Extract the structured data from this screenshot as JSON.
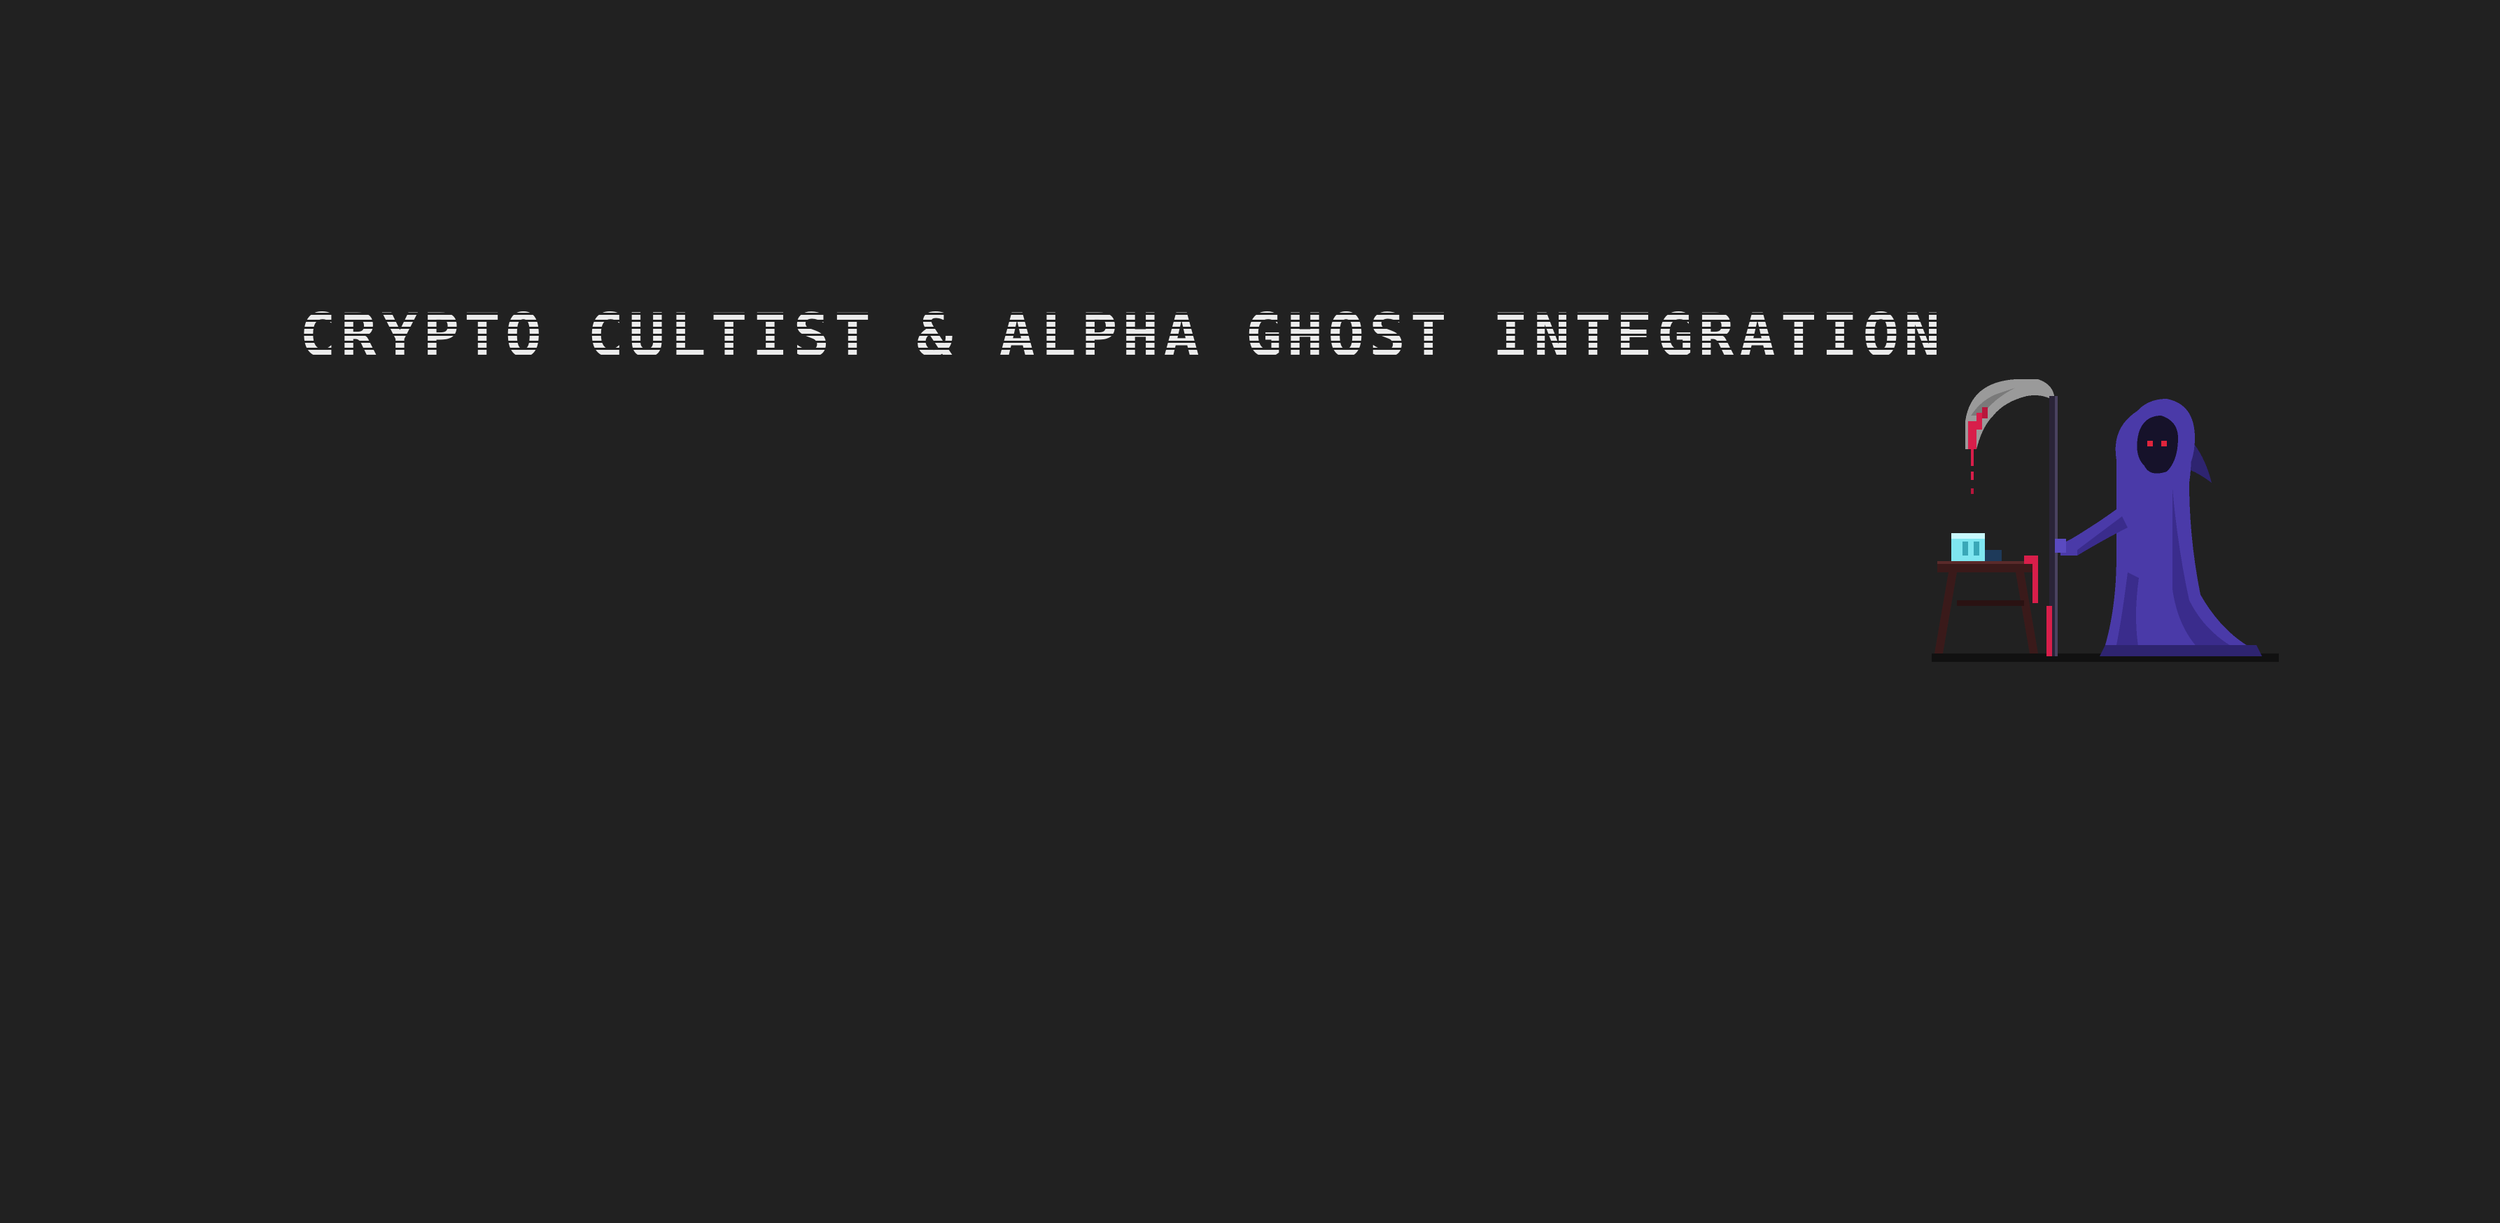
{
  "header": {
    "title": "CRYPTO CULTIST & ALPHA GHOST INTEGRATION"
  },
  "illustration": {
    "icon": "grim-reaper-icon",
    "colors": {
      "background": "#212121",
      "robe": "#4a3aa8",
      "robe_shadow": "#2e2470",
      "eyes": "#e0243c",
      "blade": "#9a9a9a",
      "blood": "#d81e4a",
      "cube": "#7fe6f0",
      "table": "#3a1a1a"
    }
  }
}
